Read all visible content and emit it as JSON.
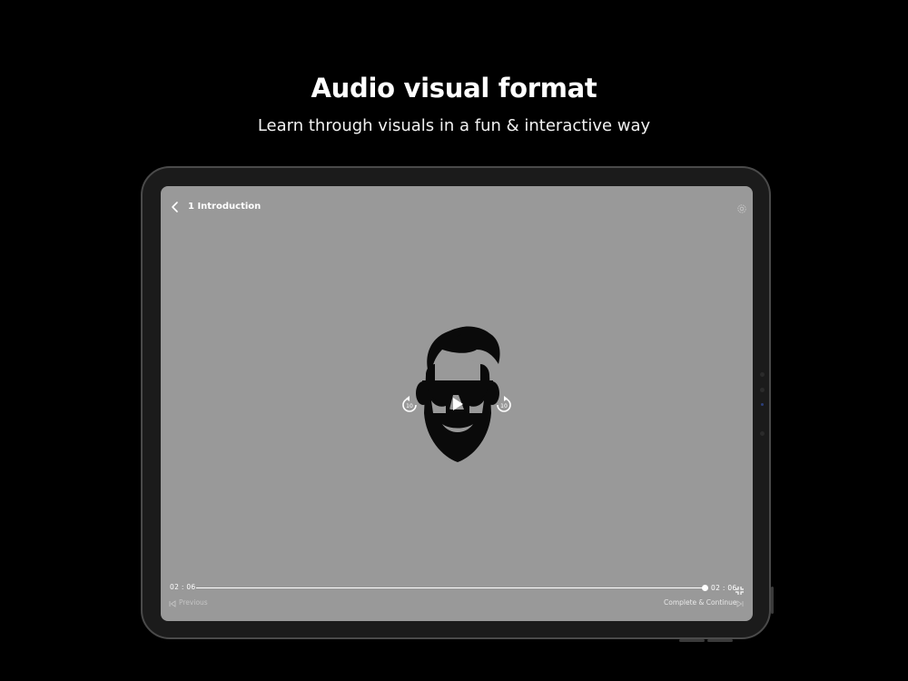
{
  "promo": {
    "headline": "Audio visual format",
    "subheadline": "Learn through visuals in a fun & interactive way"
  },
  "player": {
    "lesson_title": "1 Introduction",
    "current_time": "02 : 06",
    "total_time": "02 : 06",
    "progress": 1.0,
    "previous_label": "Previous",
    "continue_label": "Complete & Continue"
  },
  "icons": {
    "back": "chevron-left-icon",
    "settings": "gear-icon",
    "logo": "bearded-man-sunglasses-logo",
    "rewind": "rewind-10-icon",
    "play": "play-icon",
    "forward": "forward-10-icon",
    "fullscreen": "exit-fullscreen-icon",
    "previous": "skip-previous-icon",
    "next": "skip-next-icon"
  },
  "colors": {
    "background": "#000000",
    "screen": "#999999",
    "bezel": "#1b1b1b"
  }
}
